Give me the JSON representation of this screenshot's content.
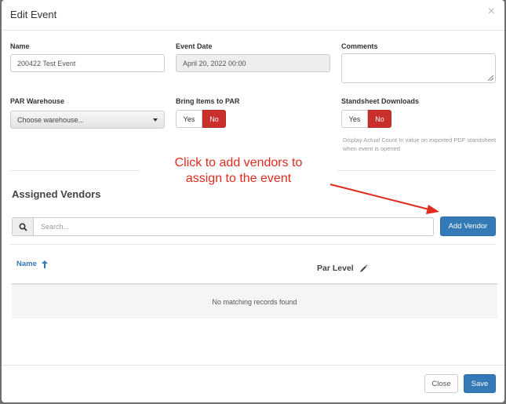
{
  "modal": {
    "title": "Edit Event",
    "close_symbol": "×"
  },
  "form": {
    "name": {
      "label": "Name",
      "value": "200422 Test Event"
    },
    "event_date": {
      "label": "Event Date",
      "value": "April 20, 2022 00:00"
    },
    "comments": {
      "label": "Comments",
      "value": ""
    },
    "par_warehouse": {
      "label": "PAR Warehouse",
      "selected": "Choose warehouse..."
    },
    "bring_items": {
      "label": "Bring Items to PAR",
      "yes": "Yes",
      "no": "No",
      "active": "No"
    },
    "standsheet": {
      "label": "Standsheet Downloads",
      "yes": "Yes",
      "no": "No",
      "active": "No",
      "help": "Display Actual Count In value on exported PDF standsheet when event is opened"
    }
  },
  "annotation": {
    "text_line1": "Click to add vendors to",
    "text_line2": "assign to the event",
    "color": "#e02b1f"
  },
  "vendors": {
    "title": "Assigned Vendors",
    "search_placeholder": "Search...",
    "add_button": "Add Vendor",
    "columns": {
      "name": "Name",
      "par_level": "Par Level"
    },
    "empty_message": "No matching records found"
  },
  "footer": {
    "close": "Close",
    "save": "Save"
  },
  "colors": {
    "primary": "#337ab7",
    "danger": "#c9302c"
  }
}
